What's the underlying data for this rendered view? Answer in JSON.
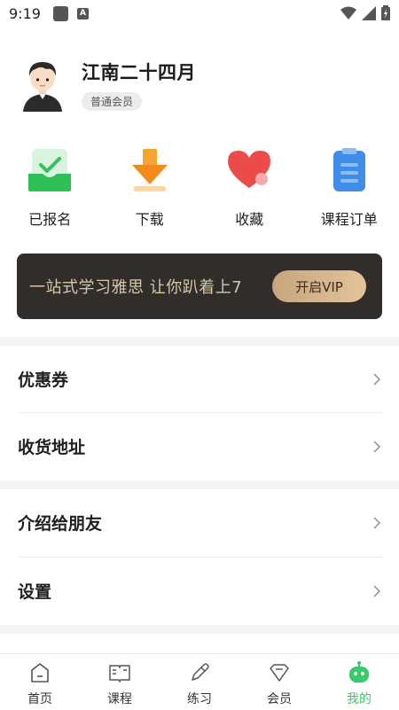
{
  "status_bar": {
    "time": "9:19",
    "a_glyph": "A"
  },
  "profile": {
    "name": "江南二十四月",
    "badge": "普通会员"
  },
  "quick_actions": [
    {
      "label": "已报名",
      "icon": "enrolled-icon"
    },
    {
      "label": "下载",
      "icon": "download-icon"
    },
    {
      "label": "收藏",
      "icon": "heart-icon"
    },
    {
      "label": "课程订单",
      "icon": "clipboard-icon"
    }
  ],
  "vip_banner": {
    "text": "一站式学习雅思 让你趴着上7",
    "button": "开启VIP"
  },
  "menu": [
    {
      "label": "优惠券"
    },
    {
      "label": "收货地址"
    },
    {
      "label": "介绍给朋友"
    },
    {
      "label": "设置"
    }
  ],
  "tabs": [
    {
      "label": "首页",
      "icon": "home-icon",
      "active": false
    },
    {
      "label": "课程",
      "icon": "book-icon",
      "active": false
    },
    {
      "label": "练习",
      "icon": "pencil-icon",
      "active": false
    },
    {
      "label": "会员",
      "icon": "diamond-icon",
      "active": false
    },
    {
      "label": "我的",
      "icon": "robot-icon",
      "active": true
    }
  ],
  "colors": {
    "accent": "#3cc96b",
    "vip_bg": "#312d2b",
    "vip_text": "#d8c7a8"
  }
}
